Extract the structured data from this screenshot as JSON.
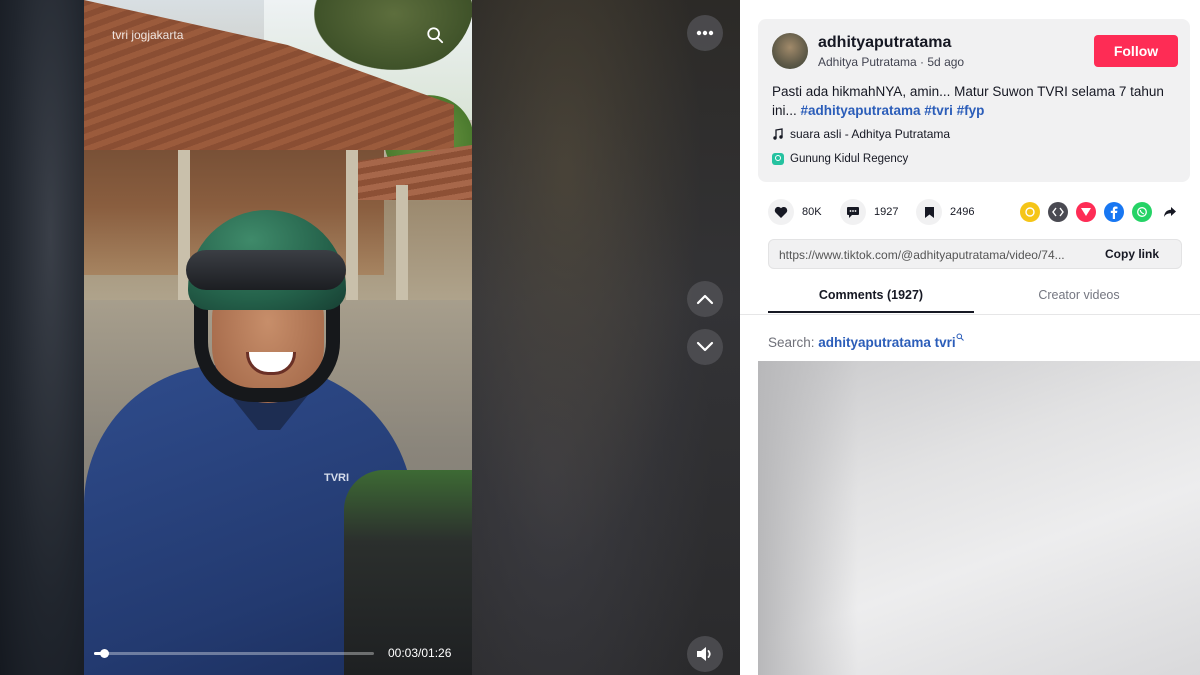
{
  "video": {
    "title": "tvri jogjakarta",
    "time": "00:03/01:26",
    "progress": 0.035,
    "logo_text": "TVRI"
  },
  "post": {
    "username": "adhityaputratama",
    "nickname_line": "Adhitya Putratama · 5d ago",
    "follow_label": "Follow",
    "description": "Pasti ada hikmahNYA, amin... Matur Suwon TVRI selama 7 tahun ini... ",
    "hashtags": "#adhityaputratama #tvri #fyp",
    "music": "suara asli - Adhitya Putratama",
    "location": "Gunung Kidul Regency"
  },
  "stats": {
    "likes": "80K",
    "comments": "1927",
    "saves": "2496"
  },
  "share_icons": [
    "friends-icon",
    "embed-icon",
    "send-to-friends-icon",
    "facebook-icon",
    "whatsapp-icon",
    "share-arrow-icon"
  ],
  "link": {
    "url": "https://www.tiktok.com/@adhityaputratama/video/74...",
    "copy_label": "Copy link"
  },
  "tabs": {
    "comments": "Comments (1927)",
    "creator": "Creator videos"
  },
  "search": {
    "label": "Search:",
    "term": "adhityaputratama tvri"
  },
  "colors": {
    "accent": "#fe2c55",
    "hashtag": "#2b5db9"
  }
}
